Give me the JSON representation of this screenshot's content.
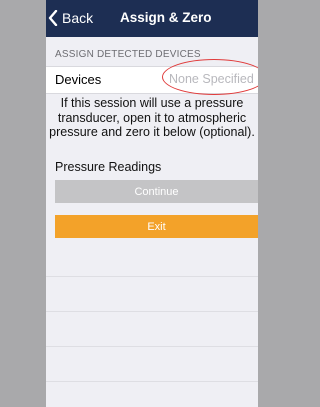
{
  "navbar": {
    "back_label": "Back",
    "title": "Assign & Zero"
  },
  "section": {
    "header": "ASSIGN DETECTED DEVICES"
  },
  "devices": {
    "label": "Devices",
    "value": "None Specified"
  },
  "info": {
    "text": "If this session will use a pressure transducer, open it to atmospheric pressure and zero it below (optional)."
  },
  "readings": {
    "label": "Pressure Readings"
  },
  "buttons": {
    "continue_label": "Continue",
    "exit_label": "Exit"
  },
  "colors": {
    "navbar": "#1d2e53",
    "exit": "#f3a229",
    "continue_disabled": "#c4c4c6",
    "highlight_ellipse": "#e03a3a"
  }
}
